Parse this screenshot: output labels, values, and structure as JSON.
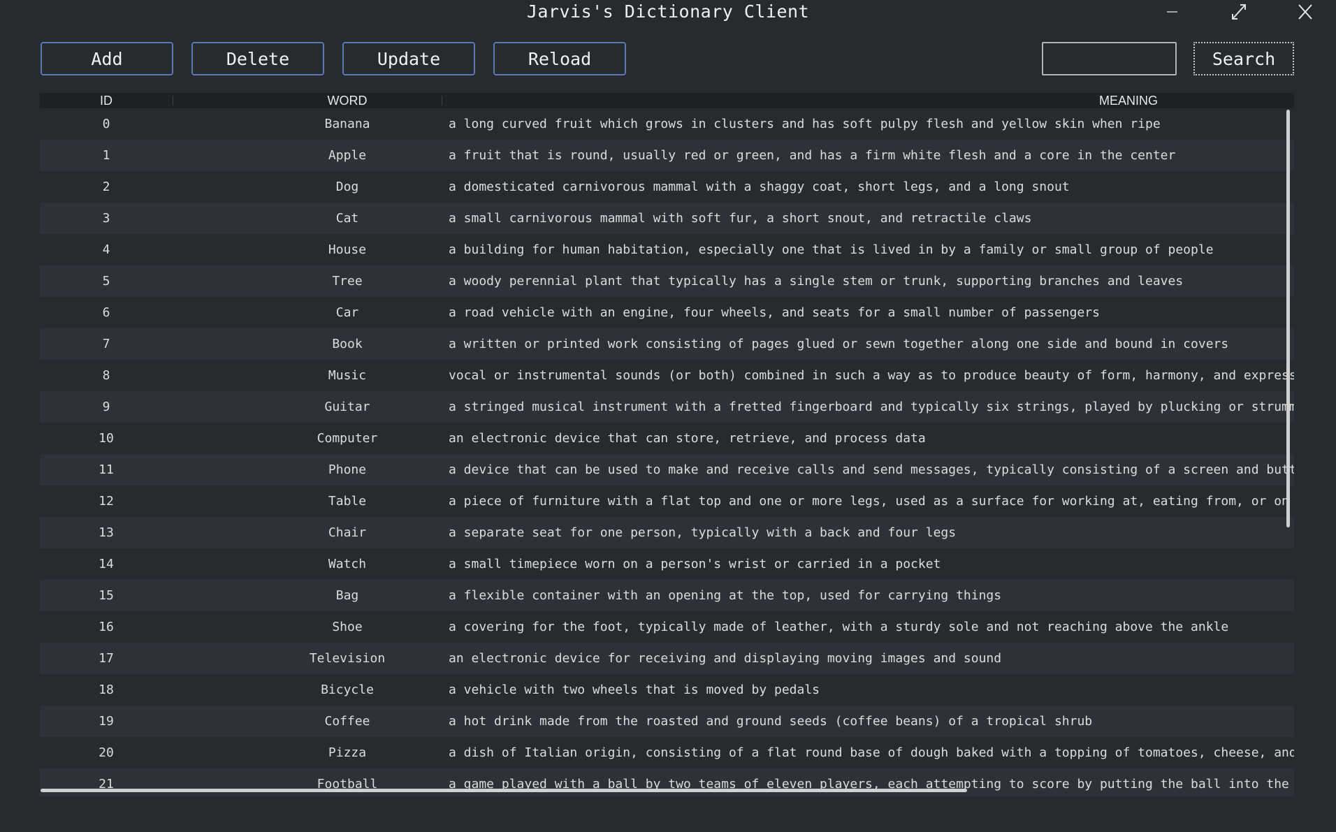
{
  "window": {
    "title": "Jarvis's Dictionary Client"
  },
  "toolbar": {
    "add_label": "Add",
    "delete_label": "Delete",
    "update_label": "Update",
    "reload_label": "Reload",
    "search_value": "",
    "search_label": "Search"
  },
  "colors": {
    "background": "#262b2f",
    "row_alt": "#2c3238",
    "header_bg": "#1d2125",
    "button_border": "#5f77b9"
  },
  "table": {
    "columns": [
      "ID",
      "WORD",
      "MEANING"
    ],
    "rows": [
      {
        "id": "0",
        "word": "Banana",
        "meaning": "a long curved fruit which grows in clusters and has soft pulpy flesh and yellow skin when ripe"
      },
      {
        "id": "1",
        "word": "Apple",
        "meaning": "a fruit that is round, usually red or green, and has a firm white flesh and a core in the center"
      },
      {
        "id": "2",
        "word": "Dog",
        "meaning": "a domesticated carnivorous mammal with a shaggy coat, short legs, and a long snout"
      },
      {
        "id": "3",
        "word": "Cat",
        "meaning": "a small carnivorous mammal with soft fur, a short snout, and retractile claws"
      },
      {
        "id": "4",
        "word": "House",
        "meaning": "a building for human habitation, especially one that is lived in by a family or small group of people"
      },
      {
        "id": "5",
        "word": "Tree",
        "meaning": "a woody perennial plant that typically has a single stem or trunk, supporting branches and leaves"
      },
      {
        "id": "6",
        "word": "Car",
        "meaning": "a road vehicle with an engine, four wheels, and seats for a small number of passengers"
      },
      {
        "id": "7",
        "word": "Book",
        "meaning": "a written or printed work consisting of pages glued or sewn together along one side and bound in covers"
      },
      {
        "id": "8",
        "word": "Music",
        "meaning": "vocal or instrumental sounds (or both) combined in such a way as to produce beauty of form, harmony, and express"
      },
      {
        "id": "9",
        "word": "Guitar",
        "meaning": "a stringed musical instrument with a fretted fingerboard and typically six strings, played by plucking or strumm"
      },
      {
        "id": "10",
        "word": "Computer",
        "meaning": "an electronic device that can store, retrieve, and process data"
      },
      {
        "id": "11",
        "word": "Phone",
        "meaning": "a device that can be used to make and receive calls and send messages, typically consisting of a screen and butt"
      },
      {
        "id": "12",
        "word": "Table",
        "meaning": "a piece of furniture with a flat top and one or more legs, used as a surface for working at, eating from, or on"
      },
      {
        "id": "13",
        "word": "Chair",
        "meaning": "a separate seat for one person, typically with a back and four legs"
      },
      {
        "id": "14",
        "word": "Watch",
        "meaning": "a small timepiece worn on a person's wrist or carried in a pocket"
      },
      {
        "id": "15",
        "word": "Bag",
        "meaning": "a flexible container with an opening at the top, used for carrying things"
      },
      {
        "id": "16",
        "word": "Shoe",
        "meaning": "a covering for the foot, typically made of leather, with a sturdy sole and not reaching above the ankle"
      },
      {
        "id": "17",
        "word": "Television",
        "meaning": "an electronic device for receiving and displaying moving images and sound"
      },
      {
        "id": "18",
        "word": "Bicycle",
        "meaning": "a vehicle with two wheels that is moved by pedals"
      },
      {
        "id": "19",
        "word": "Coffee",
        "meaning": "a hot drink made from the roasted and ground seeds (coffee beans) of a tropical shrub"
      },
      {
        "id": "20",
        "word": "Pizza",
        "meaning": "a dish of Italian origin, consisting of a flat round base of dough baked with a topping of tomatoes, cheese, and"
      },
      {
        "id": "21",
        "word": "Football",
        "meaning": "a game played with a ball by two teams of eleven players, each attempting to score by putting the ball into the"
      }
    ]
  },
  "icons": {
    "minimize": "minimize-icon",
    "maximize": "maximize-icon",
    "close": "close-icon"
  }
}
